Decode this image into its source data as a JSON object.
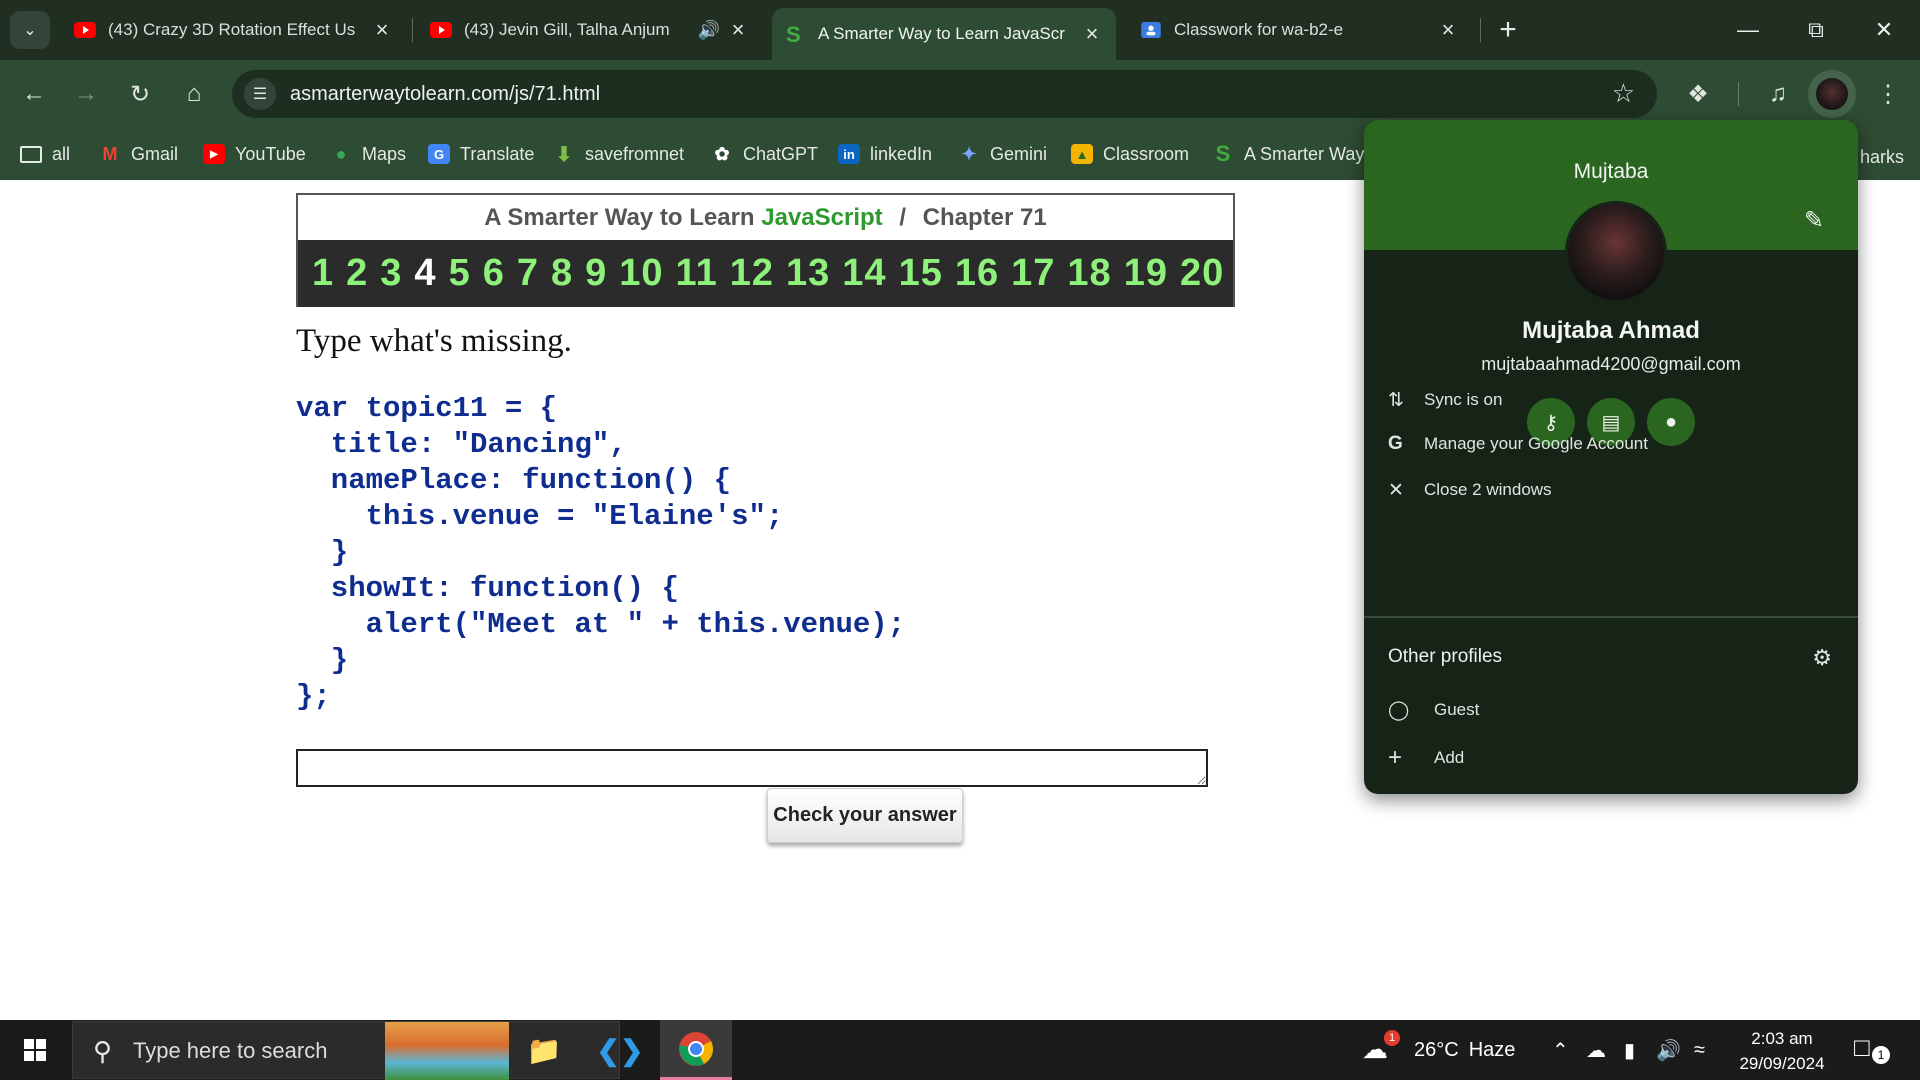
{
  "tabs": [
    {
      "title": "(43) Crazy 3D Rotation Effect Us",
      "favicon": "youtube-icon"
    },
    {
      "title": "(43) Jevin Gill, Talha Anjum",
      "favicon": "youtube-icon",
      "audio": "speaker-icon"
    },
    {
      "title": "A Smarter Way to Learn JavaScr",
      "favicon": "smarter-way-icon",
      "active": true
    },
    {
      "title": "Classwork for wa-b2-e",
      "favicon": "classroom-icon"
    }
  ],
  "toolbar": {
    "url": "asmarterwaytolearn.com/js/71.html"
  },
  "bookmarks": [
    {
      "label": "all",
      "icon": "folder-icon"
    },
    {
      "label": "Gmail",
      "icon": "gmail-icon"
    },
    {
      "label": "YouTube",
      "icon": "youtube-icon"
    },
    {
      "label": "Maps",
      "icon": "maps-icon"
    },
    {
      "label": "Translate",
      "icon": "translate-icon"
    },
    {
      "label": "savefromnet",
      "icon": "download-icon"
    },
    {
      "label": "ChatGPT",
      "icon": "chatgpt-icon"
    },
    {
      "label": "linkedIn",
      "icon": "linkedin-icon"
    },
    {
      "label": "Gemini",
      "icon": "gemini-icon"
    },
    {
      "label": "Classroom",
      "icon": "classroom-icon"
    },
    {
      "label": "A Smarter Way",
      "icon": "smarter-way-icon"
    }
  ],
  "bookmarks_more": "harks",
  "page": {
    "heading_prefix": "A Smarter Way to Learn",
    "heading_js": "JavaScript",
    "heading_sep": "/",
    "heading_chapter": "Chapter 71",
    "numbers": [
      "1",
      "2",
      "3",
      "4",
      "5",
      "6",
      "7",
      "8",
      "9",
      "10",
      "11",
      "12",
      "13",
      "14",
      "15",
      "16",
      "17",
      "18",
      "19",
      "20"
    ],
    "current_number": "4",
    "instruction": "Type what's missing.",
    "code_lines": [
      "var topic11 = {",
      "  title: \"Dancing\",",
      "  namePlace: function() {",
      "    this.venue = \"Elaine's\";",
      "  }",
      "  showIt: function() {",
      "    alert(\"Meet at \" + this.venue);",
      "  }",
      "};"
    ],
    "answer_value": "",
    "check_button": "Check your answer"
  },
  "profile": {
    "header_name": "Mujtaba",
    "full_name": "Mujtaba Ahmad",
    "email": "mujtabaahmad4200@gmail.com",
    "actions": [
      "key-icon",
      "card-icon",
      "location-icon"
    ],
    "menu": [
      {
        "label": "Sync is on",
        "icon": "sync-icon"
      },
      {
        "label": "Manage your Google Account",
        "icon": "google-icon"
      },
      {
        "label": "Close 2 windows",
        "icon": "close-icon"
      }
    ],
    "other_profiles_label": "Other profiles",
    "other_profiles": [
      {
        "label": "Guest",
        "icon": "guest-icon"
      },
      {
        "label": "Add",
        "icon": "plus-icon"
      }
    ]
  },
  "taskbar": {
    "search_placeholder": "Type here to search",
    "weather_temp": "26°C",
    "weather_desc": "Haze",
    "weather_badge": "1",
    "time": "2:03 am",
    "date": "29/09/2024",
    "notification_count": "1"
  },
  "colors": {
    "tabstrip": "#202f22",
    "toolbar": "#2e4b33",
    "profile_accent": "#2b6620",
    "chapter_numbers": "#8ef27a",
    "code": "#0f2d8f"
  }
}
